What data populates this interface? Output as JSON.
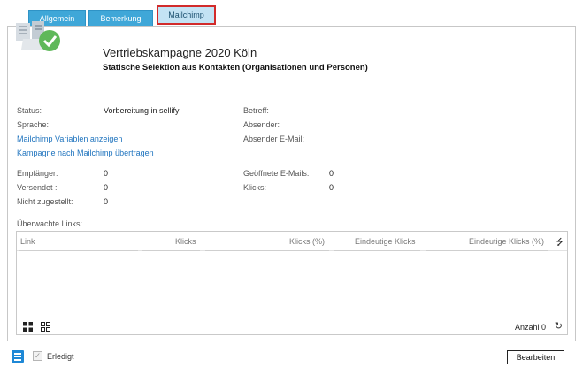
{
  "tabs": {
    "allgemein": "Allgemein",
    "bemerkung": "Bemerkung",
    "mailchimp": "Mailchimp"
  },
  "header": {
    "title": "Vertriebskampagne 2020 Köln",
    "subtitle": "Statische Selektion aus Kontakten (Organisationen und Personen)"
  },
  "details": {
    "status_label": "Status:",
    "status_value": "Vorbereitung in sellify",
    "sprache_label": "Sprache:",
    "betreff_label": "Betreff:",
    "absender_label": "Absender:",
    "absender_email_label": "Absender E-Mail:",
    "link_variablen": "Mailchimp Variablen anzeigen",
    "link_uebertragen": "Kampagne nach Mailchimp übertragen"
  },
  "stats": {
    "empfaenger_label": "Empfänger:",
    "empfaenger_value": "0",
    "versendet_label": "Versendet :",
    "versendet_value": "0",
    "nicht_zugestellt_label": "Nicht zugestellt:",
    "nicht_zugestellt_value": "0",
    "geoeffnet_label": "Geöffnete E-Mails:",
    "geoeffnet_value": "0",
    "klicks_label": "Klicks:",
    "klicks_value": "0"
  },
  "links_grid": {
    "section_label": "Überwachte Links:",
    "columns": [
      "Link",
      "Klicks",
      "Klicks (%)",
      "Eindeutige Klicks",
      "Eindeutige Klicks (%)"
    ],
    "rows": [],
    "count_label": "Anzahl 0"
  },
  "footer": {
    "erledigt_label": "Erledigt",
    "erledigt_checked": true,
    "edit_button": "Bearbeiten"
  },
  "icons": {
    "campaign": "campaign-done-icon",
    "menu": "hamburger-menu-icon",
    "refresh": "refresh-icon",
    "grid_large": "grid-large-icon",
    "grid_small": "grid-small-icon",
    "sort": "sort-icon"
  },
  "colors": {
    "tab_active_border": "#d22b2b",
    "tab_bg": "#3fa7d8",
    "link": "#1e73be",
    "check_green": "#5fb85a"
  }
}
